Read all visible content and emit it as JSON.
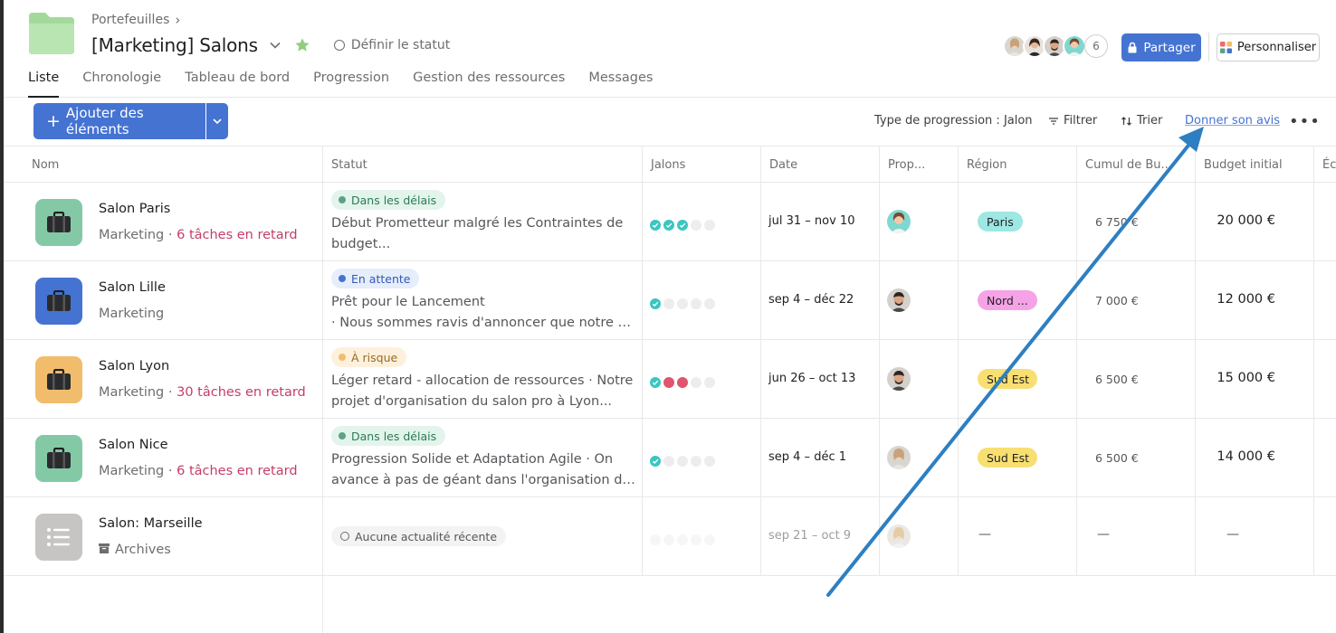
{
  "header": {
    "breadcrumb": "Portefeuilles",
    "title": "[Marketing] Salons",
    "set_status": "Définir le statut",
    "member_count": "6",
    "share_label": "Partager",
    "customize_label": "Personnaliser"
  },
  "tabs": [
    {
      "label": "Liste",
      "active": true
    },
    {
      "label": "Chronologie"
    },
    {
      "label": "Tableau de bord"
    },
    {
      "label": "Progression"
    },
    {
      "label": "Gestion des ressources"
    },
    {
      "label": "Messages"
    }
  ],
  "toolbar": {
    "add_label": "Ajouter des éléments",
    "progress_type": "Type de progression : Jalon",
    "filter": "Filtrer",
    "sort": "Trier",
    "feedback": "Donner son avis"
  },
  "columns": [
    "Nom",
    "Statut",
    "Jalons",
    "Date",
    "Prop...",
    "Région",
    "Cumul de Bu...",
    "Budget initial",
    "Éca"
  ],
  "rows": [
    {
      "name": "Salon Paris",
      "team": "Marketing",
      "sep": " · ",
      "late": "6 tâches en retard",
      "icon_color": "#84c9a6",
      "status_label": "Dans les délais",
      "status_color": "#5da283",
      "status_bg": "#e3f4ec",
      "status_text_color": "#2b7a55",
      "status_line1": "Début Prometteur malgré les Contraintes de",
      "status_line2": "budget...",
      "milestones": [
        "done",
        "done",
        "done",
        "empty",
        "empty"
      ],
      "date": "jul 31 – nov 10",
      "region": "Paris",
      "region_bg": "#9ee7e3",
      "cumul": "6 750 €",
      "budget": "20 000 €",
      "owner": "f1"
    },
    {
      "name": "Salon Lille",
      "team": "Marketing",
      "sep": "",
      "late": "",
      "icon_color": "#4573d2",
      "status_label": "En attente",
      "status_color": "#4573d2",
      "status_bg": "#e6edfb",
      "status_text_color": "#3359b5",
      "status_line1": "Prêt pour le Lancement",
      "status_line2": "· Nous sommes ravis d'annoncer que notre proj...",
      "milestones": [
        "done",
        "empty",
        "empty",
        "empty",
        "empty"
      ],
      "date": "sep 4 – déc 22",
      "region": "Nord ...",
      "region_bg": "#f5a3e6",
      "cumul": "7 000 €",
      "budget": "12 000 €",
      "owner": "m1"
    },
    {
      "name": "Salon Lyon",
      "team": "Marketing",
      "sep": " · ",
      "late": "30 tâches en retard",
      "icon_color": "#f1bd6c",
      "status_label": "À risque",
      "status_color": "#f1bd6c",
      "status_bg": "#fdf1de",
      "status_text_color": "#9a6a1f",
      "status_line1": "Léger retard - allocation de ressources · Notre",
      "status_line2": "projet d'organisation du salon pro à Lyon...",
      "milestones": [
        "done",
        "missed",
        "missed",
        "empty",
        "empty"
      ],
      "date": "jun 26 – oct 13",
      "region": "Sud Est",
      "region_bg": "#f8df72",
      "cumul": "6 500 €",
      "budget": "15 000 €",
      "owner": "m1"
    },
    {
      "name": "Salon Nice",
      "team": "Marketing",
      "sep": " · ",
      "late": "6 tâches en retard",
      "icon_color": "#84c9a6",
      "status_label": "Dans les délais",
      "status_color": "#5da283",
      "status_bg": "#e3f4ec",
      "status_text_color": "#2b7a55",
      "status_line1": "Progression Solide et Adaptation Agile · On",
      "status_line2": "avance à pas de géant dans l'organisation de...",
      "milestones": [
        "done",
        "empty",
        "empty",
        "empty",
        "empty"
      ],
      "date": "sep 4 – déc 1",
      "region": "Sud Est",
      "region_bg": "#f8df72",
      "cumul": "6 500 €",
      "budget": "14 000 €",
      "owner": "f2"
    },
    {
      "name": "Salon: Marseille",
      "team": "Archives",
      "archived": true,
      "icon_color": "#c7c4c4",
      "status_none": "Aucune actualité récente",
      "milestones": [
        "faint",
        "faint",
        "faint",
        "faint",
        "faint"
      ],
      "date": "sep 21 – oct 9",
      "region": "—",
      "cumul": "—",
      "budget": "—",
      "owner": "f3"
    }
  ],
  "colors": {
    "accent": "#4573d2",
    "late": "#c43e66",
    "arrow": "#2e7fc1"
  }
}
